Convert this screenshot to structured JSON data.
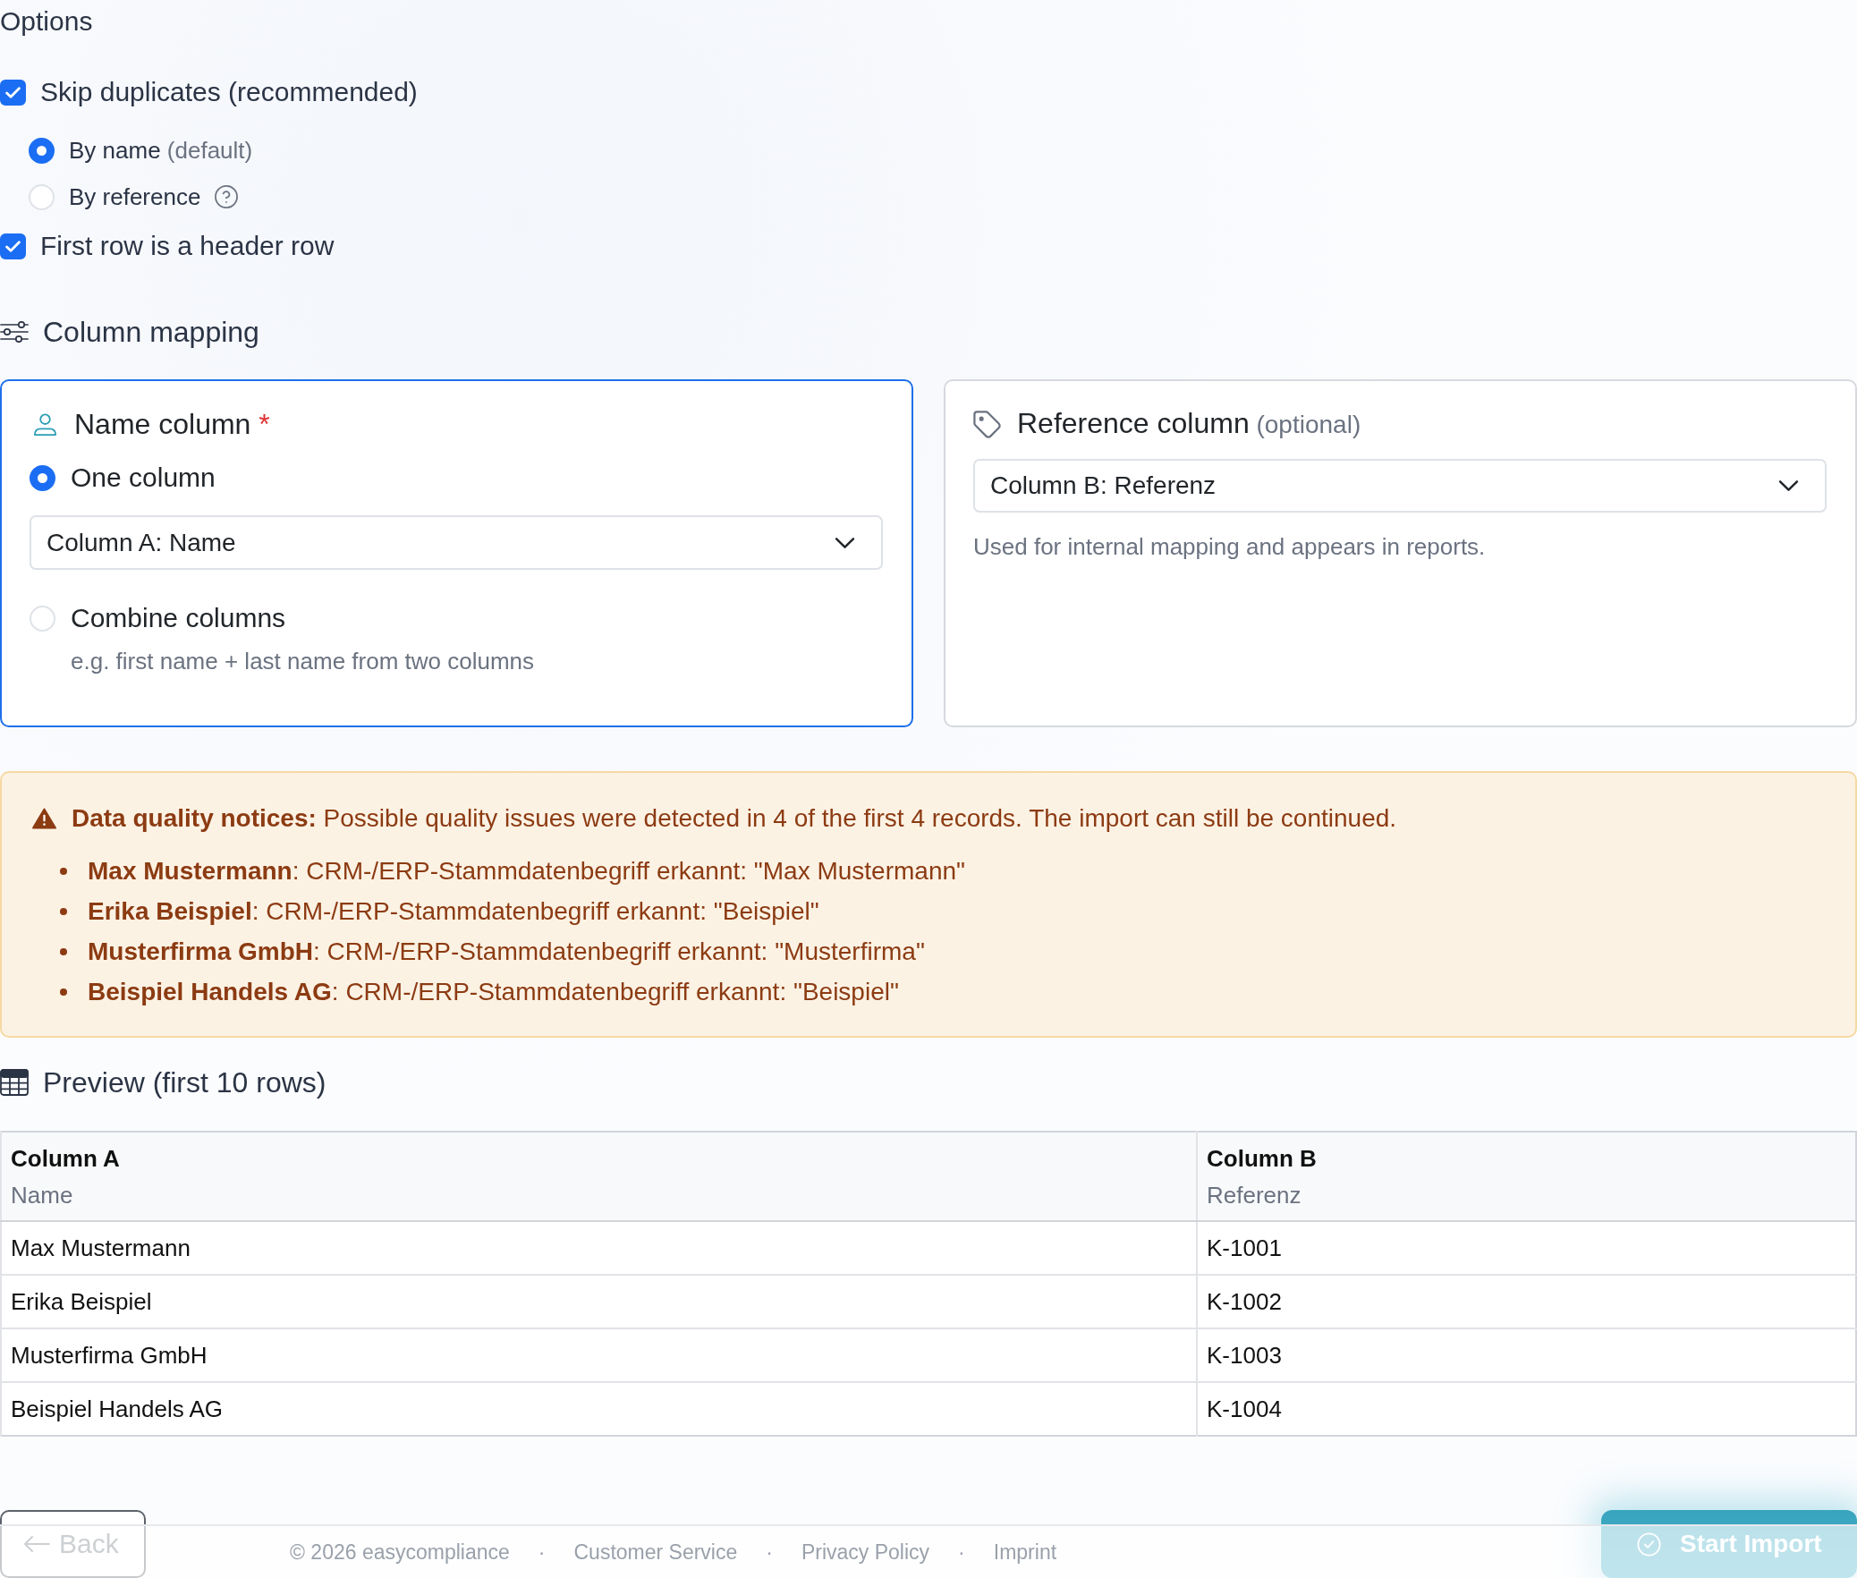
{
  "options": {
    "title": "Options",
    "items": [
      {
        "label": "Skip duplicates (recommended)",
        "checked": true,
        "children": [
          {
            "label": "By name",
            "note": "(default)",
            "help": false,
            "selected": true
          },
          {
            "label": "By reference",
            "help": true,
            "selected": false
          }
        ]
      },
      {
        "label": "First row is a header row",
        "checked": true
      }
    ]
  },
  "column_mapping": {
    "title": "Column mapping",
    "cards": [
      {
        "kind": "name",
        "title": "Name column",
        "required_mark": "*",
        "focused": true,
        "modes": [
          {
            "label": "One column",
            "selected": true,
            "select": "Column A: Name"
          },
          {
            "label": "Combine columns",
            "selected": false,
            "hint": "e.g. first name + last name from two columns"
          }
        ]
      },
      {
        "kind": "reference",
        "title": "Reference column",
        "note": "(optional)",
        "focused": false,
        "select": "Column B: Referenz",
        "hint": "Used for internal mapping and appears in reports."
      }
    ]
  },
  "notice": {
    "text": "**Data quality notices:** Possible quality issues were detected in 4 of the first 4 records. The import can still be continued.",
    "items": [
      "**Max Mustermann**: CRM-/ERP-Stammdatenbegriff erkannt: \"Max Mustermann\"",
      "**Erika Beispiel**: CRM-/ERP-Stammdatenbegriff erkannt: \"Beispiel\"",
      "**Musterfirma GmbH**: CRM-/ERP-Stammdatenbegriff erkannt: \"Musterfirma\"",
      "**Beispiel Handels AG**: CRM-/ERP-Stammdatenbegriff erkannt: \"Beispiel\""
    ]
  },
  "preview": {
    "title": "Preview (first 10 rows)",
    "table": {
      "columns": [
        {
          "label": "Column A",
          "subtitle": "Name"
        },
        {
          "label": "Column B",
          "subtitle": "Referenz"
        }
      ],
      "rows": [
        [
          "Max Mustermann",
          "K-1001"
        ],
        [
          "Erika Beispiel",
          "K-1002"
        ],
        [
          "Musterfirma GmbH",
          "K-1003"
        ],
        [
          "Beispiel Handels AG",
          "K-1004"
        ]
      ]
    }
  },
  "actions": {
    "back": "Back",
    "start": "Start Import"
  },
  "footer": {
    "copyright": "© 2026 easycompliance",
    "links": [
      {
        "separator": "·",
        "label": "Customer Service"
      },
      {
        "separator": "·",
        "label": "Privacy Policy"
      },
      {
        "separator": "·",
        "label": "Imprint"
      }
    ]
  }
}
